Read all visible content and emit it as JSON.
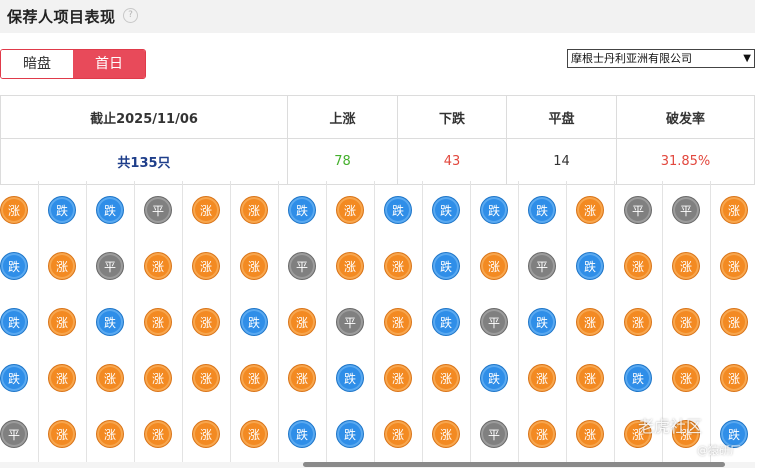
{
  "header": {
    "title": "保荐人项目表现",
    "help_icon": "?"
  },
  "toggle": {
    "options": [
      "暗盘",
      "首日"
    ],
    "selected": "首日"
  },
  "sponsor_select": {
    "value": "摩根士丹利亚洲有限公司"
  },
  "summary": {
    "headers": [
      "截止2025/11/06",
      "上涨",
      "下跌",
      "平盘",
      "破发率"
    ],
    "total": "共135只",
    "up": "78",
    "down": "43",
    "flat": "14",
    "break_rate": "31.85%"
  },
  "legend_labels": {
    "up": "涨",
    "down": "跌",
    "flat": "平"
  },
  "colors": {
    "up": "#f38a22",
    "down": "#2f8ee8",
    "flat": "#808080",
    "accent": "#e84a5a"
  },
  "grid": [
    [
      "up",
      "down",
      "down",
      "flat",
      "up",
      "up",
      "down",
      "up",
      "down",
      "down",
      "down",
      "down",
      "up",
      "flat",
      "flat",
      "up"
    ],
    [
      "down",
      "up",
      "flat",
      "up",
      "up",
      "up",
      "flat",
      "up",
      "up",
      "down",
      "up",
      "flat",
      "down",
      "up",
      "up",
      "up"
    ],
    [
      "down",
      "up",
      "down",
      "up",
      "up",
      "down",
      "up",
      "flat",
      "up",
      "down",
      "flat",
      "down",
      "up",
      "up",
      "up",
      "up"
    ],
    [
      "down",
      "up",
      "up",
      "up",
      "up",
      "up",
      "up",
      "down",
      "up",
      "up",
      "down",
      "up",
      "up",
      "down",
      "up",
      "up"
    ],
    [
      "flat",
      "up",
      "up",
      "up",
      "up",
      "up",
      "down",
      "down",
      "up",
      "up",
      "flat",
      "up",
      "up",
      "up",
      "up",
      "down"
    ]
  ],
  "watermark": {
    "brand": "老虎社区",
    "handle": "@猿研厂"
  }
}
